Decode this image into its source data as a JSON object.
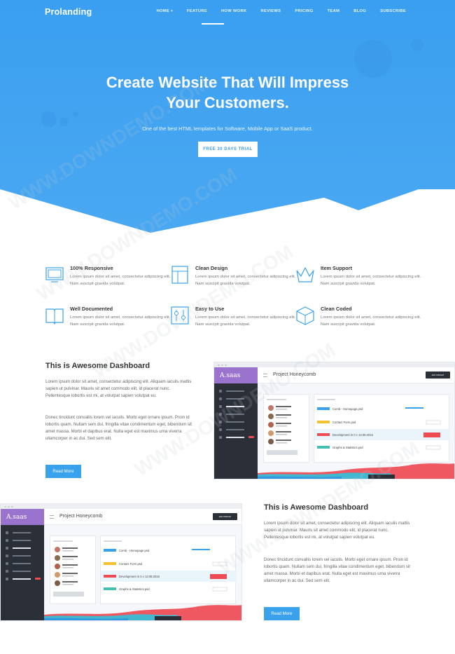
{
  "nav": {
    "logo": "Prolanding",
    "links": [
      "HOME",
      "FEATURE",
      "HOW WORK",
      "REVIEWS",
      "PRICING",
      "TEAM",
      "BLOG",
      "SUBSCRIBE"
    ]
  },
  "hero": {
    "title_line1": "Create Website That Will Impress",
    "title_line2": "Your Customers.",
    "subtitle": "One of the best HTML templates for Software, Mobile App or SaaS product.",
    "cta": "FREE 30 DAYS TRIAL"
  },
  "features": [
    {
      "icon": "monitor-icon",
      "title": "100% Responsive",
      "desc": "Lorem ipsum dolor sit amet, consectetur adipiscing elit. Nam suscipit gravida volutpat."
    },
    {
      "icon": "layout-icon",
      "title": "Clean Design",
      "desc": "Lorem ipsum dolor sit amet, consectetur adipiscing elit. Nam suscipit gravida volutpat."
    },
    {
      "icon": "crown-icon",
      "title": "Item Support",
      "desc": "Lorem ipsum dolor sit amet, consectetur adipiscing elit. Nam suscipit gravida volutpat."
    },
    {
      "icon": "book-icon",
      "title": "Well Documented",
      "desc": "Lorem ipsum dolor sit amet, consectetur adipiscing elit. Nam suscipit gravida volutpat."
    },
    {
      "icon": "sliders-icon",
      "title": "Easy to Use",
      "desc": "Lorem ipsum dolor sit amet, consectetur adipiscing elit. Nam suscipit gravida volutpat."
    },
    {
      "icon": "cube-icon",
      "title": "Clean Coded",
      "desc": "Lorem ipsum dolor sit amet, consectetur adipiscing elit. Nam suscipit gravida volutpat."
    }
  ],
  "section1": {
    "title": "This is Awesome Dashboard",
    "p1": "Lorem ipsum dolor sit amet, consectetur adipiscing elit. Aliquam iaculis mattis sapien ut pulvinar. Mauris sit amet commodo elit, id placerat nunc. Pellentesque lobortis est mi, at volutpat sapien volutpat eu.",
    "p2": "Donec tincidunt convallis lorem vel iaculis. Morbi eget ornare ipsum. Proin id lobortis quam. Nullam sem dui, fringilla vitae condimentum eget, bibendum sit amet massa. Morbi et dapibus erat. Nulla eget est maximus urna viverra ullamcorper in ac dui. Sed sem elit.",
    "button": "Read More"
  },
  "section2": {
    "title": "This is Awesome Dashboard",
    "p1": "Lorem ipsum dolor sit amet, consectetur adipiscing elit. Aliquam iaculis mattis sapien ut pulvinar. Mauris sit amet commodo elit, id placerat nunc. Pellentesque lobortis est mi, at volutpat sapien volutpat eu.",
    "p2": "Donec tincidunt convallis lorem vel iaculis. Morbi eget ornare ipsum. Proin id lobortis quam. Nullam sem dui, fringilla vitae condimentum eget, bibendum sit amet massa. Morbi et dapibus erat. Nulla eget est maximus urna viverra ullamcorper in ac dui. Sed sem elit.",
    "button": "Read More"
  },
  "dashboard": {
    "logo": "A.saas",
    "title": "Project Honeycomb",
    "widget_button": "ADD WIDGET",
    "files": [
      "Comb - Homepage.psd",
      "Contact Form.psd",
      "Development in 0 v 13.08.2016",
      "Graphs & Statistics.psd"
    ]
  },
  "watermark": "WWW.DOWNDEMO.COM",
  "colors": {
    "hero_top": "#3aa0ef",
    "hero_bottom": "#47a6f0",
    "accent": "#3aa2ec",
    "dashboard_purple": "#9a73cf",
    "dashboard_dark": "#2b2f38",
    "danger": "#ef4b55"
  }
}
